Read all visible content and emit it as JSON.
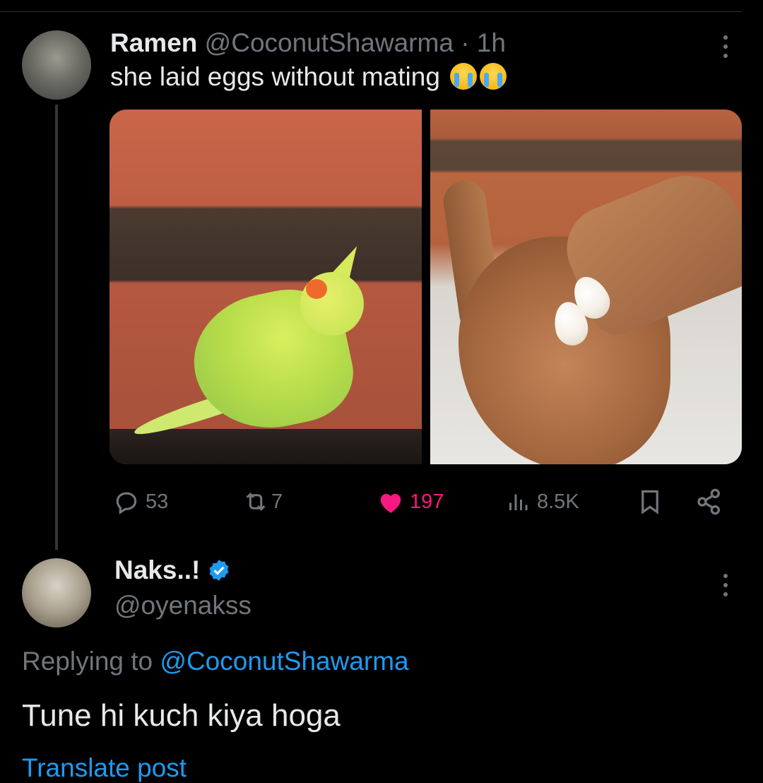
{
  "tweet": {
    "author_name": "Ramen",
    "author_handle": "@CoconutShawarma",
    "timestamp": "· 1h",
    "text": "she laid eggs without mating",
    "emoji": [
      "loudly-crying-face",
      "loudly-crying-face"
    ],
    "media": [
      "cockatiel photo",
      "eggs in palm photo"
    ],
    "actions": {
      "replies": "53",
      "retweets": "7",
      "likes": "197",
      "views": "8.5K"
    }
  },
  "reply": {
    "author_name": "Naks..!",
    "verified": true,
    "author_handle": "@oyenakss",
    "replying_prefix": "Replying to",
    "replying_to": "@CoconutShawarma",
    "text": "Tune hi kuch kiya hoga",
    "cutoff_text": "Translate post"
  },
  "colors": {
    "background": "#000000",
    "text": "#e7e9ea",
    "muted": "#71767b",
    "accent": "#1d9bf0",
    "like": "#f91880"
  }
}
